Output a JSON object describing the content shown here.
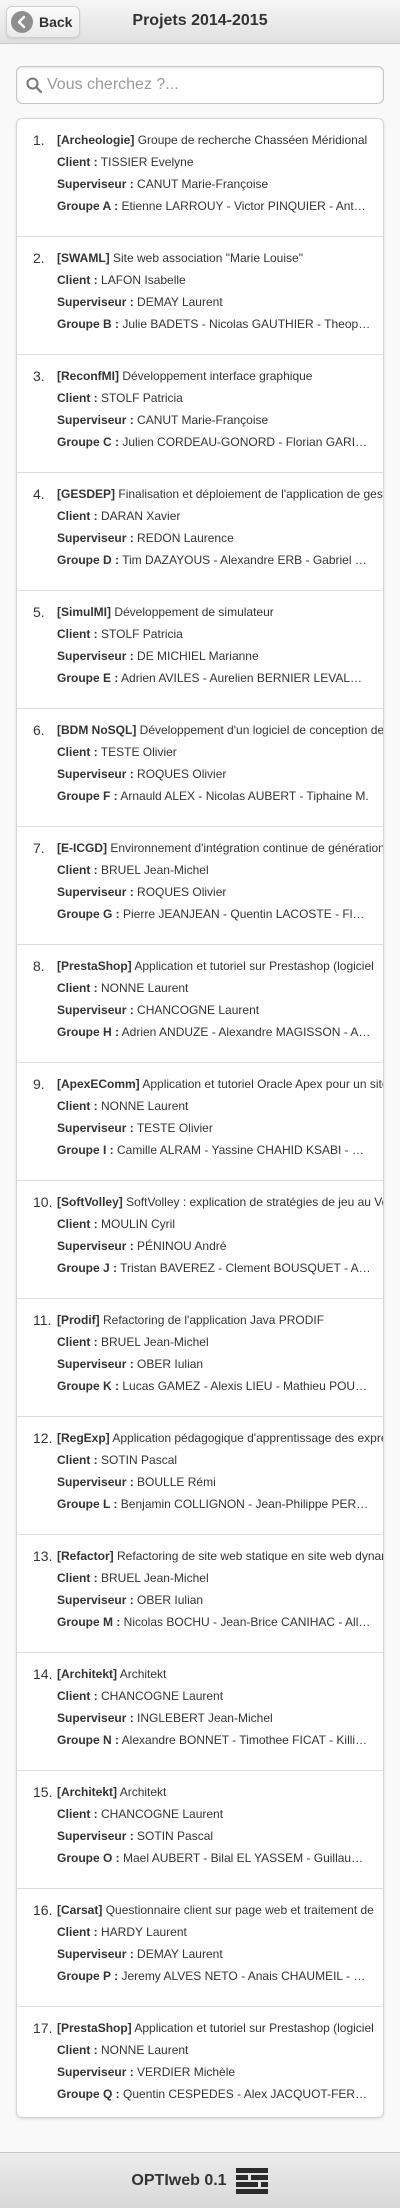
{
  "header": {
    "back_label": "Back",
    "title": "Projets 2014-2015"
  },
  "search": {
    "placeholder": "Vous cherchez ?..."
  },
  "labels": {
    "client": "Client :",
    "superviseur": "Superviseur :"
  },
  "projects": [
    {
      "num": "1.",
      "tag": "[Archeologie]",
      "title": "Groupe de recherche Chasséen Méridional",
      "client": "TISSIER Evelyne",
      "superviseur": "CANUT Marie-Françoise",
      "groupe_label": "Groupe A :",
      "groupe": "Etienne LARROUY - Victor PINQUIER - Antoine ..."
    },
    {
      "num": "2.",
      "tag": "[SWAML]",
      "title": "Site web association \"Marie Louise\"",
      "client": "LAFON Isabelle",
      "superviseur": "DEMAY Laurent",
      "groupe_label": "Groupe B :",
      "groupe": "Julie BADETS - Nicolas GAUTHIER - Theophile ..."
    },
    {
      "num": "3.",
      "tag": "[ReconfMI]",
      "title": "Développement interface graphique",
      "client": "STOLF Patricia",
      "superviseur": "CANUT Marie-Françoise",
      "groupe_label": "Groupe C :",
      "groupe": "Julien CORDEAU-GONORD - Florian GARIBAL ..."
    },
    {
      "num": "4.",
      "tag": "[GESDEP]",
      "title": "Finalisation et déploiement de l'application de gestion",
      "client": "DARAN Xavier",
      "superviseur": "REDON Laurence",
      "groupe_label": "Groupe D :",
      "groupe": "Tim DAZAYOUS - Alexandre ERB - Gabriel GA..."
    },
    {
      "num": "5.",
      "tag": "[SimulMI]",
      "title": "Développement de simulateur",
      "client": "STOLF Patricia",
      "superviseur": "DE MICHIEL Marianne",
      "groupe_label": "Groupe E :",
      "groupe": "Adrien AVILES - Aurelien BERNIER LEVALOIS ..."
    },
    {
      "num": "6.",
      "tag": "[BDM NoSQL]",
      "title": "Développement d'un logiciel de conception de",
      "client": "TESTE Olivier",
      "superviseur": "ROQUES Olivier",
      "groupe_label": "Groupe F :",
      "groupe": "Arnauld ALEX - Nicolas AUBERT - Tiphaine M."
    },
    {
      "num": "7.",
      "tag": "[E-ICGD]",
      "title": "Environnement d'intégration continue de génération",
      "client": "BRUEL Jean-Michel",
      "superviseur": "ROQUES Olivier",
      "groupe_label": "Groupe G :",
      "groupe": "Pierre JEANJEAN - Quentin LACOSTE - Florian ..."
    },
    {
      "num": "8.",
      "tag": "[PrestaShop]",
      "title": "Application et tutoriel sur Prestashop (logiciel",
      "client": "NONNE Laurent",
      "superviseur": "CHANCOGNE Laurent",
      "groupe_label": "Groupe H :",
      "groupe": "Adrien ANDUZE - Alexandre MAGISSON - Anne ..."
    },
    {
      "num": "9.",
      "tag": "[ApexEComm]",
      "title": "Application et tutoriel Oracle Apex pour un site",
      "client": "NONNE Laurent",
      "superviseur": "TESTE Olivier",
      "groupe_label": "Groupe I :",
      "groupe": "Camille ALRAM - Yassine CHAHID KSABI - Rémi ..."
    },
    {
      "num": "10.",
      "tag": "[SoftVolley]",
      "title": "SoftVolley : explication de stratégies de jeu au Volley",
      "client": "MOULIN Cyril",
      "superviseur": "PÉNINOU André",
      "groupe_label": "Groupe J :",
      "groupe": "Tristan BAVEREZ - Clement BOUSQUET - Adrien ..."
    },
    {
      "num": "11.",
      "tag": "[Prodif]",
      "title": "Refactoring de l'application Java PRODIF",
      "client": "BRUEL Jean-Michel",
      "superviseur": "OBER Iulian",
      "groupe_label": "Groupe K :",
      "groupe": "Lucas GAMEZ - Alexis LIEU - Mathieu POUXVIEL ..."
    },
    {
      "num": "12.",
      "tag": "[RegExp]",
      "title": "Application pédagogique d'apprentissage des expressions",
      "client": "SOTIN Pascal",
      "superviseur": "BOULLE Rémi",
      "groupe_label": "Groupe L :",
      "groupe": "Benjamin COLLIGNON - Jean-Philippe PERNOT ..."
    },
    {
      "num": "13.",
      "tag": "[Refactor]",
      "title": "Refactoring de site web statique en site web dynamique",
      "client": "BRUEL Jean-Michel",
      "superviseur": "OBER Iulian",
      "groupe_label": "Groupe M :",
      "groupe": "Nicolas BOCHU - Jean-Brice CANIHAC - Alla..."
    },
    {
      "num": "14.",
      "tag": "[Architekt]",
      "title": "Architekt",
      "client": "CHANCOGNE Laurent",
      "superviseur": "INGLEBERT Jean-Michel",
      "groupe_label": "Groupe N :",
      "groupe": "Alexandre BONNET - Timothee FICAT - Killian ..."
    },
    {
      "num": "15.",
      "tag": "[Architekt]",
      "title": "Architekt",
      "client": "CHANCOGNE Laurent",
      "superviseur": "SOTIN Pascal",
      "groupe_label": "Groupe O :",
      "groupe": "Mael AUBERT - Bilal EL YASSEM - Guillaume ..."
    },
    {
      "num": "16.",
      "tag": "[Carsat]",
      "title": "Questionnaire client sur page web et traitement de",
      "client": "HARDY Laurent",
      "superviseur": "DEMAY Laurent",
      "groupe_label": "Groupe P :",
      "groupe": "Jeremy ALVES NETO - Anais CHAUMEIL - Loic ..."
    },
    {
      "num": "17.",
      "tag": "[PrestaShop]",
      "title": "Application et tutoriel sur Prestashop (logiciel",
      "client": "NONNE Laurent",
      "superviseur": "VERDIER Michèle",
      "groupe_label": "Groupe Q :",
      "groupe": "Quentin CESPEDES - Alex JACQUOT-FERNANDEZ ..."
    }
  ],
  "footer": {
    "text": "OPTIweb 0.1",
    "logo_icon": "stacked-bars-logo"
  },
  "colors": {
    "header_bg": "#e9e9e9",
    "back_circle": "#8e8e8e",
    "list_bg": "#ffffff",
    "border": "#d4d4d4",
    "text": "#333333"
  }
}
